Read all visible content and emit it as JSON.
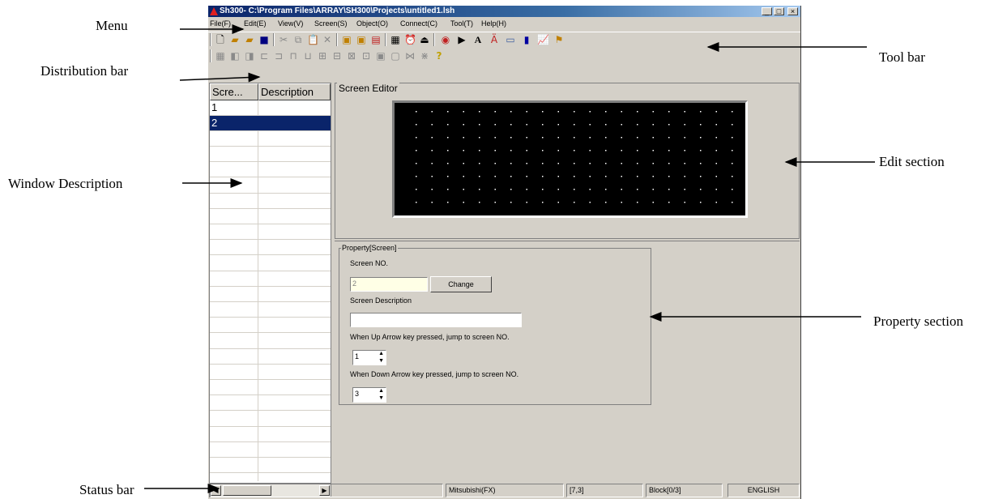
{
  "annotations": {
    "menu": "Menu",
    "distribution_bar": "Distribution bar",
    "window_description": "Window Description",
    "status_bar": "Status bar",
    "tool_bar": "Tool bar",
    "edit_section": "Edit section",
    "property_section": "Property section"
  },
  "window": {
    "title": "Sh300- C:\\Program Files\\ARRAY\\SH300\\Projects\\untitled1.lsh",
    "controls": [
      "_",
      "□",
      "×"
    ]
  },
  "menu": [
    "File(F)",
    "Edit(E)",
    "View(V)",
    "Screen(S)",
    "Object(O)",
    "Connect(C)",
    "Tool(T)",
    "Help(H)"
  ],
  "toolbar_icons": [
    "new-icon",
    "open-icon",
    "open-folder-icon",
    "save-icon",
    "cut-icon",
    "copy-icon",
    "paste-icon",
    "delete-icon",
    "screen-add-icon",
    "screen-copy-icon",
    "screen-icon",
    "properties-icon",
    "alarm-icon",
    "download-icon",
    "record-icon",
    "play-icon",
    "text-icon",
    "multi-text-icon",
    "bitmap-icon",
    "bar-icon",
    "trend-icon",
    "flag-icon"
  ],
  "distribution_icons": [
    "grid-icon",
    "bring-front-icon",
    "send-back-icon",
    "align-left-icon",
    "align-right-icon",
    "align-top-icon",
    "align-bottom-icon",
    "align-center-h-icon",
    "align-center-v-icon",
    "distribute-h-icon",
    "distribute-v-icon",
    "same-size-icon",
    "same-width-icon",
    "same-height-icon",
    "same-space-icon",
    "help-icon"
  ],
  "screen_list": {
    "headers": [
      "Scre...",
      "Description"
    ],
    "rows": [
      {
        "no": "1",
        "description": "",
        "selected": false
      },
      {
        "no": "2",
        "description": "",
        "selected": true
      }
    ]
  },
  "editor": {
    "legend": "Screen Editor"
  },
  "property": {
    "legend": "Property[Screen]",
    "screen_no_label": "Screen NO.",
    "screen_no_value": "2",
    "change_label": "Change",
    "description_label": "Screen Description",
    "description_value": "",
    "up_label": "When Up Arrow key pressed, jump to screen NO.",
    "up_value": "1",
    "down_label": "When Down Arrow key pressed, jump to screen  NO.",
    "down_value": "3"
  },
  "status": {
    "plc": "Mitsubishi(FX)",
    "coords": "[7,3]",
    "block": "Block[0/3]",
    "language": "ENGLISH"
  }
}
